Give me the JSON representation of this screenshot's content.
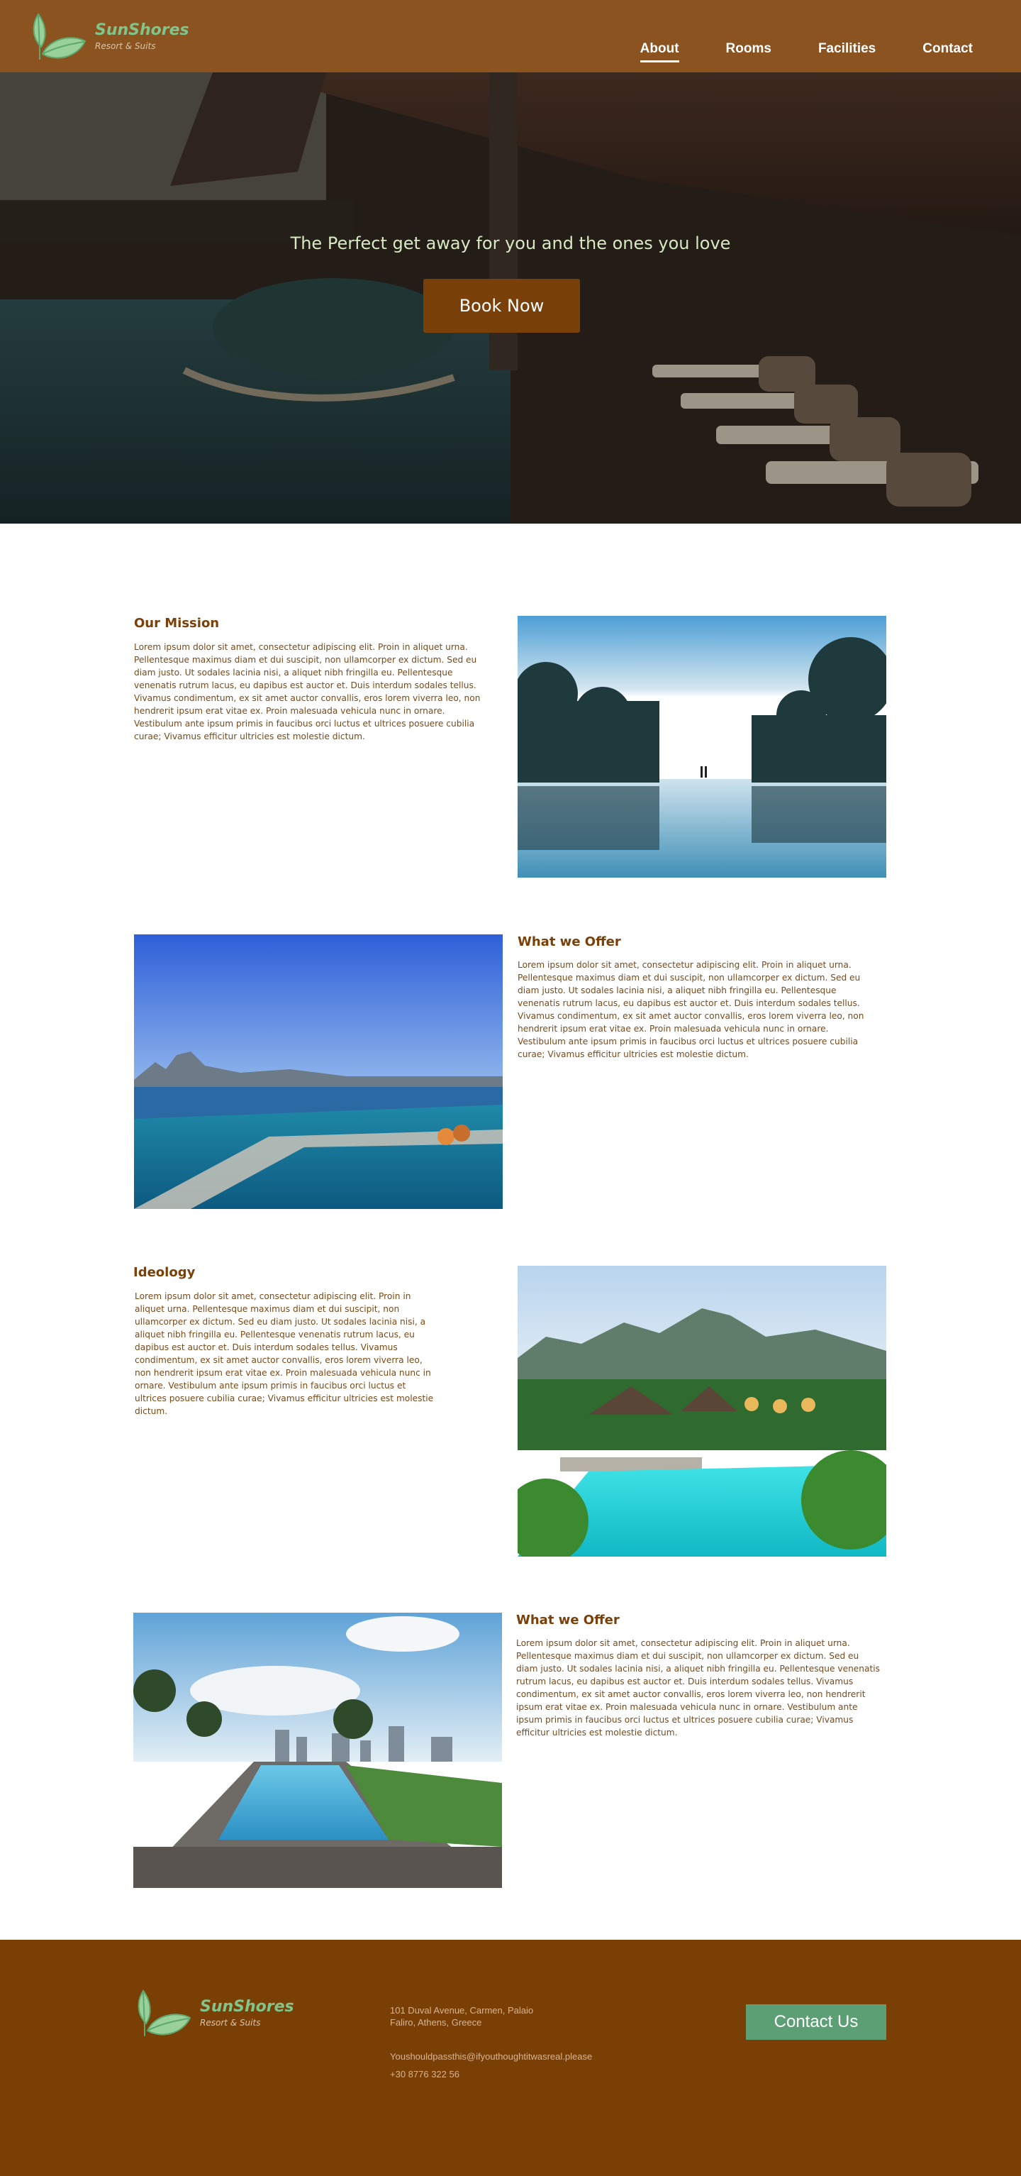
{
  "nav": {
    "brand": "SunShores",
    "tagline": "Resort & Suits",
    "links": [
      {
        "label": "About"
      },
      {
        "label": "Rooms"
      },
      {
        "label": "Facilities"
      },
      {
        "label": "Contact"
      }
    ],
    "active": "About"
  },
  "hero": {
    "title": "The Perfect get away for you and the ones you love",
    "button": "Book Now"
  },
  "sections": [
    {
      "title": "Our Mission",
      "body": "Lorem ipsum dolor sit amet, consectetur adipiscing elit. Proin in aliquet urna. Pellentesque maximus diam et dui suscipit, non ullamcorper ex dictum. Sed eu diam justo. Ut sodales lacinia nisi, a aliquet nibh fringilla eu. Pellentesque venenatis rutrum lacus, eu dapibus est auctor et. Duis interdum sodales tellus. Vivamus condimentum, ex sit amet auctor convallis, eros lorem viverra leo, non hendrerit ipsum erat vitae ex. Proin malesuada vehicula nunc in ornare. Vestibulum ante ipsum primis in faucibus orci luctus et ultrices posuere cubilia curae; Vivamus efficitur ultricies est molestie dictum.",
      "image": "infinity-pool-sunset-photo"
    },
    {
      "title": "What we Offer",
      "body": "Lorem ipsum dolor sit amet, consectetur adipiscing elit. Proin in aliquet urna. Pellentesque maximus diam et dui suscipit, non ullamcorper ex dictum. Sed eu diam justo. Ut sodales lacinia nisi, a aliquet nibh fringilla eu. Pellentesque venenatis rutrum lacus, eu dapibus est auctor et. Duis interdum sodales tellus. Vivamus condimentum, ex sit amet auctor convallis, eros lorem viverra leo, non hendrerit ipsum erat vitae ex. Proin malesuada vehicula nunc in ornare. Vestibulum ante ipsum primis in faucibus orci luctus et ultrices posuere cubilia curae; Vivamus efficitur ultricies est molestie dictum.",
      "image": "rooftop-pool-ocean-photo"
    },
    {
      "title": "Ideology",
      "body": "Lorem ipsum dolor sit amet, consectetur adipiscing elit. Proin in aliquet urna. Pellentesque maximus diam et dui suscipit, non ullamcorper ex dictum. Sed eu diam justo. Ut sodales lacinia nisi, a aliquet nibh fringilla eu. Pellentesque venenatis rutrum lacus, eu dapibus est auctor et. Duis interdum sodales tellus. Vivamus condimentum, ex sit amet auctor convallis, eros lorem viverra leo, non hendrerit ipsum erat vitae ex. Proin malesuada vehicula nunc in ornare. Vestibulum ante ipsum primis in faucibus orci luctus et ultrices posuere cubilia curae; Vivamus efficitur ultricies est molestie dictum.",
      "image": "tropical-resort-pool-photo"
    },
    {
      "title": "What we Offer",
      "body": "Lorem ipsum dolor sit amet, consectetur adipiscing elit. Proin in aliquet urna. Pellentesque maximus diam et dui suscipit, non ullamcorper ex dictum. Sed eu diam justo. Ut sodales lacinia nisi, a aliquet nibh fringilla eu. Pellentesque venenatis rutrum lacus, eu dapibus est auctor et. Duis interdum sodales tellus. Vivamus condimentum, ex sit amet auctor convallis, eros lorem viverra leo, non hendrerit ipsum erat vitae ex. Proin malesuada vehicula nunc in ornare. Vestibulum ante ipsum primis in faucibus orci luctus et ultrices posuere cubilia curae; Vivamus efficitur ultricies est molestie dictum.",
      "image": "city-lap-pool-photo"
    }
  ],
  "footer": {
    "brand": "SunShores",
    "tagline": "Resort & Suits",
    "address": "101 Duval Avenue, Carmen, Palaio Faliro, Athens, Greece",
    "email": "Youshouldpassthis@ifyouthoughtitwasreal.please",
    "phone": "+30 8776 322 56",
    "button": "Contact Us"
  },
  "colors": {
    "nav_bg": "#8a5320",
    "accent_brown": "#7a4009",
    "brand_green": "#7fc58c",
    "footer_bg": "#7a3f05",
    "contact_button": "#5d9f74"
  }
}
